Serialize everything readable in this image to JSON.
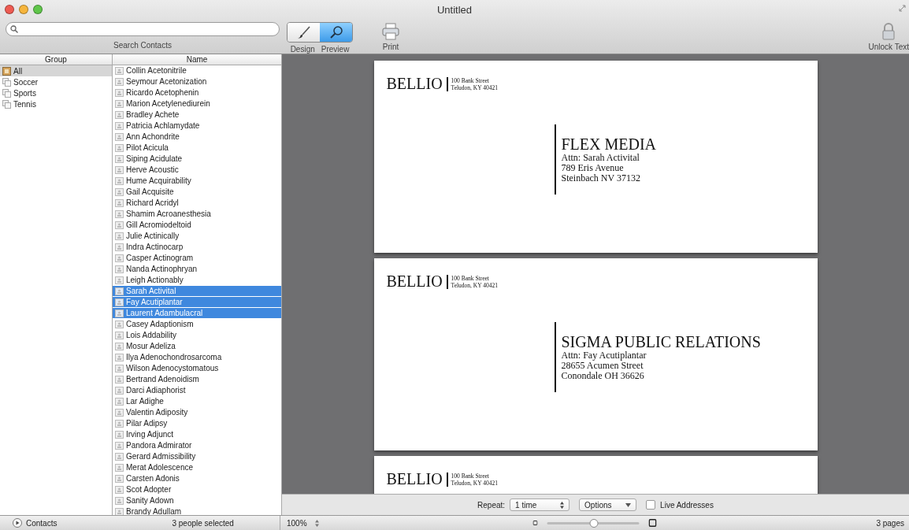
{
  "window": {
    "title": "Untitled"
  },
  "toolbar": {
    "search_label": "Search Contacts",
    "view_modes": [
      {
        "label": "Design",
        "kind": "brush",
        "selected": false
      },
      {
        "label": "Preview",
        "kind": "magnifier",
        "selected": true
      }
    ],
    "print": "Print",
    "unlock": "Unlock Text"
  },
  "groups": {
    "header": "Group",
    "items": [
      {
        "label": "All",
        "kind": "all",
        "selected": true
      },
      {
        "label": "Soccer",
        "kind": "group",
        "selected": false
      },
      {
        "label": "Sports",
        "kind": "group",
        "selected": false
      },
      {
        "label": "Tennis",
        "kind": "group",
        "selected": false
      }
    ]
  },
  "names": {
    "header": "Name",
    "items": [
      {
        "label": "Collin Acetonitrile",
        "selected": false
      },
      {
        "label": "Seymour Acetonization",
        "selected": false
      },
      {
        "label": "Ricardo Acetophenin",
        "selected": false
      },
      {
        "label": "Marion Acetylenediurein",
        "selected": false
      },
      {
        "label": "Bradley Achete",
        "selected": false
      },
      {
        "label": "Patricia Achlamydate",
        "selected": false
      },
      {
        "label": "Ann Achondrite",
        "selected": false
      },
      {
        "label": "Pilot Acicula",
        "selected": false
      },
      {
        "label": "Siping Acidulate",
        "selected": false
      },
      {
        "label": "Herve Acoustic",
        "selected": false
      },
      {
        "label": "Hume Acquirability",
        "selected": false
      },
      {
        "label": "Gail Acquisite",
        "selected": false
      },
      {
        "label": "Richard Acridyl",
        "selected": false
      },
      {
        "label": "Shamim Acroanesthesia",
        "selected": false
      },
      {
        "label": "Gill Acromiodeltoid",
        "selected": false
      },
      {
        "label": "Julie Actinically",
        "selected": false
      },
      {
        "label": "Indra Actinocarp",
        "selected": false
      },
      {
        "label": "Casper Actinogram",
        "selected": false
      },
      {
        "label": "Nanda Actinophryan",
        "selected": false
      },
      {
        "label": "Leigh Actionably",
        "selected": false
      },
      {
        "label": "Sarah Activital",
        "selected": true
      },
      {
        "label": "Fay Acutiplantar",
        "selected": true
      },
      {
        "label": "Laurent Adambulacral",
        "selected": true
      },
      {
        "label": "Casey Adaptionism",
        "selected": false
      },
      {
        "label": "Lois Addability",
        "selected": false
      },
      {
        "label": "Mosur Adeliza",
        "selected": false
      },
      {
        "label": "Ilya Adenochondrosarcoma",
        "selected": false
      },
      {
        "label": "Wilson Adenocystomatous",
        "selected": false
      },
      {
        "label": "Bertrand Adenoidism",
        "selected": false
      },
      {
        "label": "Darci Adiaphorist",
        "selected": false
      },
      {
        "label": "Lar Adighe",
        "selected": false
      },
      {
        "label": "Valentin Adiposity",
        "selected": false
      },
      {
        "label": "Pilar Adipsy",
        "selected": false
      },
      {
        "label": "Irving Adjunct",
        "selected": false
      },
      {
        "label": "Pandora Admirator",
        "selected": false
      },
      {
        "label": "Gerard Admissibility",
        "selected": false
      },
      {
        "label": "Merat Adolescence",
        "selected": false
      },
      {
        "label": "Carsten Adonis",
        "selected": false
      },
      {
        "label": "Scot Adopter",
        "selected": false
      },
      {
        "label": "Sanity Adown",
        "selected": false
      },
      {
        "label": "Brandy Adullam",
        "selected": false
      }
    ]
  },
  "envelopes": [
    {
      "sender": "BELLIO",
      "sender_lines": [
        "100 Bank Street",
        "Teludon, KY 40421"
      ],
      "company": "FLEX MEDIA",
      "lines": [
        "Attn: Sarah Activital",
        "789 Eris Avenue",
        "Steinbach NV 37132"
      ]
    },
    {
      "sender": "BELLIO",
      "sender_lines": [
        "100 Bank Street",
        "Teludon, KY 40421"
      ],
      "company": "SIGMA PUBLIC RELATIONS",
      "lines": [
        "Attn: Fay Acutiplantar",
        "28655 Acumen Street",
        "Conondale OH 36626"
      ]
    },
    {
      "sender": "BELLIO",
      "sender_lines": [
        "100 Bank Street",
        "Teludon, KY 40421"
      ]
    }
  ],
  "options_bar": {
    "repeat_label": "Repeat:",
    "repeat_value": "1 time",
    "options": "Options",
    "live_addresses": {
      "label": "Live Addresses",
      "checked": false
    }
  },
  "status": {
    "contacts": "Contacts",
    "selection": "3 people selected",
    "zoom": "100%",
    "size_slider": {
      "level": 0.5
    },
    "pages": "3 pages"
  }
}
